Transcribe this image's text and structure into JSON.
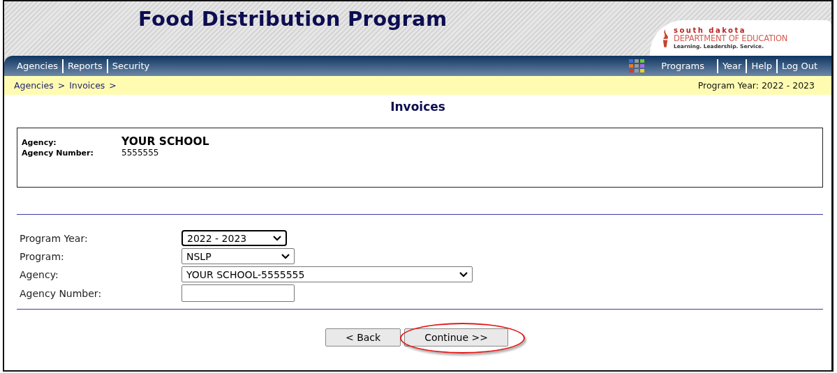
{
  "header": {
    "title": "Food Distribution Program",
    "logo": {
      "line_1": "south dakota",
      "line_2": "DEPARTMENT OF EDUCATION",
      "tagline": "Learning. Leadership. Service."
    }
  },
  "nav": {
    "left": [
      "Agencies",
      "Reports",
      "Security"
    ],
    "right": [
      "Programs",
      "Year",
      "Help",
      "Log Out"
    ]
  },
  "breadcrumb": {
    "items": [
      "Agencies",
      "Invoices"
    ],
    "separator": ">",
    "program_year": "Program Year: 2022 - 2023"
  },
  "page_title": "Invoices",
  "agency_box": {
    "agency_label": "Agency:",
    "agency_name": "YOUR SCHOOL",
    "number_label": "Agency Number:",
    "number": "5555555"
  },
  "form": [
    {
      "label": "Program Year:",
      "kind": "select",
      "value": "2022 - 2023",
      "focused": true
    },
    {
      "label": "Program:",
      "kind": "select",
      "value": "NSLP",
      "focused": false
    },
    {
      "label": "Agency:",
      "kind": "select",
      "value": "YOUR SCHOOL-5555555",
      "focused": false
    },
    {
      "label": "Agency Number:",
      "kind": "text",
      "focused": false
    }
  ],
  "buttons": [
    {
      "label": "< Back",
      "circled": false
    },
    {
      "label": "Continue >>",
      "circled": true
    }
  ]
}
